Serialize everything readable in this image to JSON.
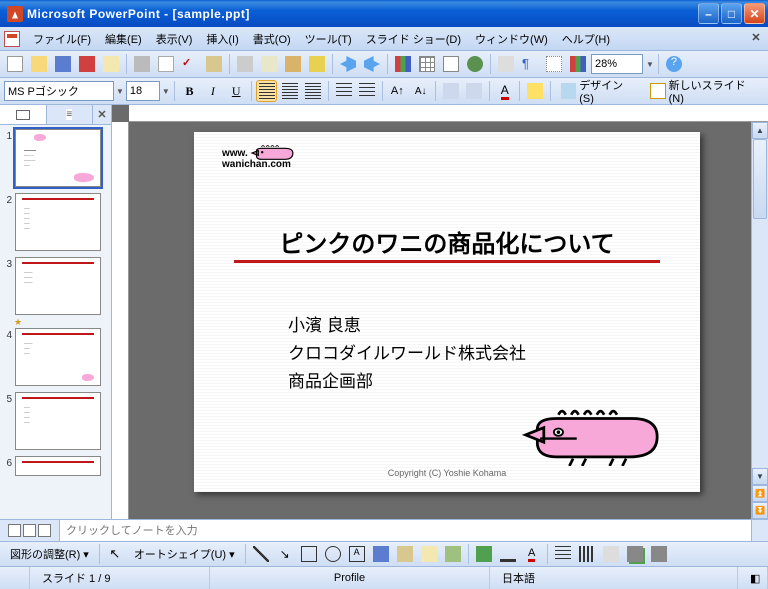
{
  "titlebar": {
    "title": "Microsoft PowerPoint - [sample.ppt]"
  },
  "menu": {
    "file": "ファイル(F)",
    "edit": "編集(E)",
    "view": "表示(V)",
    "insert": "挿入(I)",
    "format": "書式(O)",
    "tools": "ツール(T)",
    "slideshow": "スライド ショー(D)",
    "window": "ウィンドウ(W)",
    "help": "ヘルプ(H)"
  },
  "format_toolbar": {
    "font_name": "MS Pゴシック",
    "font_size": "18",
    "design": "デザイン(S)",
    "new_slide": "新しいスライド(N)"
  },
  "standard_toolbar": {
    "zoom": "28%"
  },
  "slide": {
    "logo_line1": "www.",
    "logo_line2": "wanichan.com",
    "title": "ピンクのワニの商品化について",
    "author": "小濱 良恵",
    "company": "クロコダイルワールド株式会社",
    "dept": "商品企画部",
    "copyright": "Copyright (C) Yoshie Kohama"
  },
  "thumbnails": [
    "1",
    "2",
    "3",
    "4",
    "5",
    "6"
  ],
  "notes": {
    "placeholder": "クリックしてノートを入力"
  },
  "drawbar": {
    "adjust": "図形の調整(R)",
    "autoshape": "オートシェイプ(U)"
  },
  "status": {
    "slide": "スライド 1 / 9",
    "layout": "Profile",
    "lang": "日本語"
  }
}
